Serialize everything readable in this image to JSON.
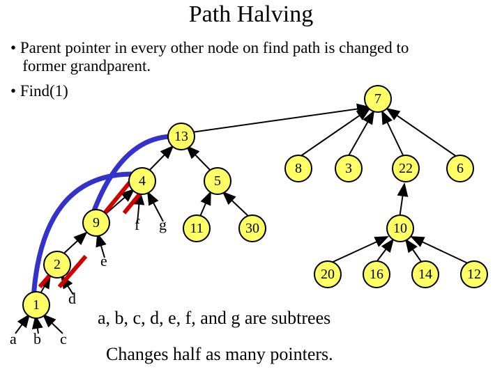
{
  "title": "Path Halving",
  "bullet1_line1": "Parent pointer in every other node on find path is changed to",
  "bullet1_line2": "former grandparent.",
  "bullet2": "Find(1)",
  "nodes": {
    "n7": "7",
    "n13": "13",
    "n8": "8",
    "n3": "3",
    "n22": "22",
    "n6": "6",
    "n4": "4",
    "n5": "5",
    "n9": "9",
    "n11": "11",
    "n30": "30",
    "n10": "10",
    "n2": "2",
    "n20": "20",
    "n16": "16",
    "n14": "14",
    "n12": "12",
    "n1": "1"
  },
  "leaves": {
    "e": "e",
    "f": "f",
    "g": "g",
    "d": "d",
    "a": "a",
    "b": "b",
    "c": "c"
  },
  "caption1": "a, b, c, d, e, f, and g are subtrees",
  "caption2": "Changes half as many pointers."
}
